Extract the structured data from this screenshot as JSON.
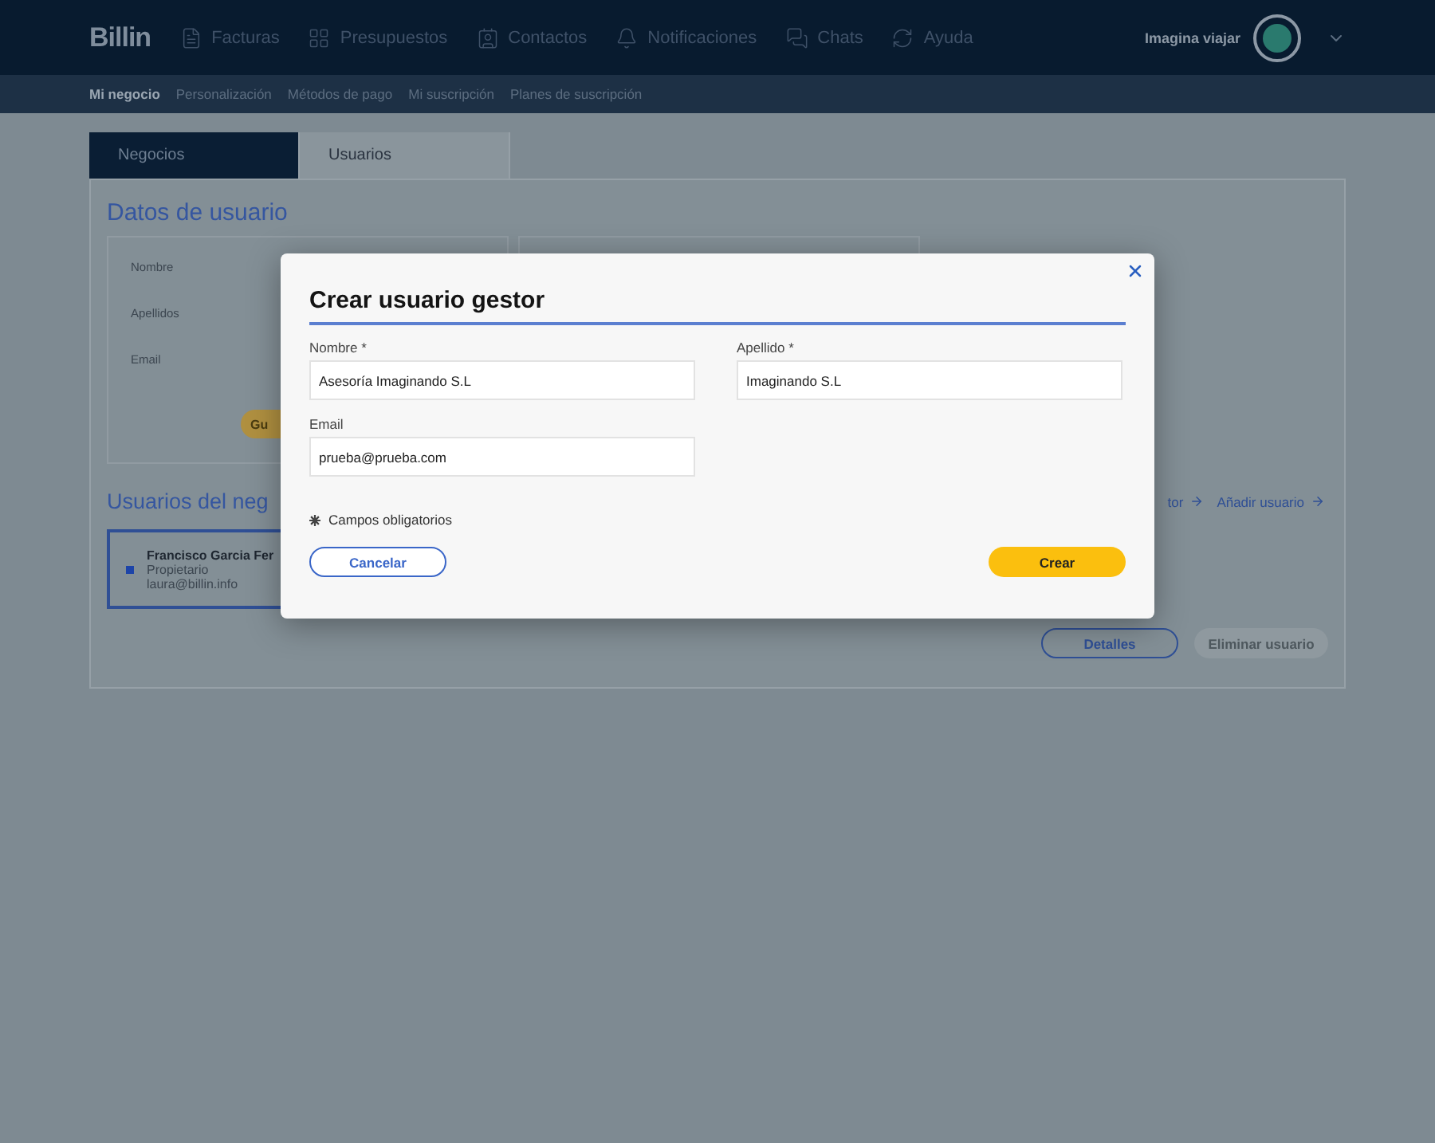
{
  "header": {
    "logo": "Billin",
    "nav": [
      {
        "kind": "invoices",
        "label": "Facturas"
      },
      {
        "kind": "quotes",
        "label": "Presupuestos"
      },
      {
        "kind": "contacts",
        "label": "Contactos"
      },
      {
        "kind": "notifications",
        "label": "Notificaciones"
      },
      {
        "kind": "chats",
        "label": "Chats"
      },
      {
        "kind": "help",
        "label": "Ayuda"
      }
    ],
    "account": "Imagina viajar"
  },
  "subnav": [
    {
      "label": "Mi negocio",
      "selected": true
    },
    {
      "label": "Personalización",
      "selected": false
    },
    {
      "label": "Métodos de pago",
      "selected": false
    },
    {
      "label": "Mi suscripción",
      "selected": false
    },
    {
      "label": "Planes de suscripción",
      "selected": false
    }
  ],
  "tabs": [
    {
      "label": "Negocios",
      "selected": false
    },
    {
      "label": "Usuarios",
      "selected": true
    }
  ],
  "user_data": {
    "title": "Datos de usuario",
    "labels": [
      "Nombre",
      "Apellidos",
      "Email"
    ],
    "save_button": "Gu"
  },
  "users_section": {
    "title": "Usuarios del neg",
    "links": [
      "tor",
      "Añadir usuario"
    ],
    "user": {
      "name": "Francisco Garcia Fer",
      "role": "Propietario",
      "email": "laura@billin.info",
      "selected": true
    },
    "details_button": "Detalles",
    "delete_button": {
      "label": "Eliminar usuario",
      "disabled": true
    }
  },
  "modal": {
    "title": "Crear usuario gestor",
    "fields": [
      {
        "label": "Nombre *",
        "value": "Asesoría Imaginando S.L"
      },
      {
        "label": "Apellido *",
        "value": "Imaginando S.L"
      },
      {
        "label": "Email",
        "value": "prueba@prueba.com"
      }
    ],
    "note": "Campos obligatorios",
    "cancel": "Cancelar",
    "submit": "Crear"
  }
}
